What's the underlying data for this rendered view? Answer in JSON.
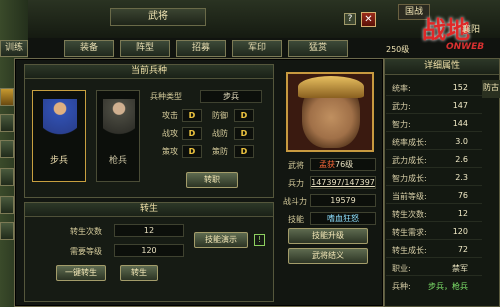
{
  "window": {
    "title": "武将",
    "help": "?",
    "close": "✕"
  },
  "top_right": {
    "label1": "国战",
    "label2": "襄阳",
    "logo": "战地",
    "logo_sub": "ONWEB",
    "badge": "250级"
  },
  "tabs": [
    {
      "label": "训练"
    },
    {
      "label": "装备"
    },
    {
      "label": "阵型"
    },
    {
      "label": "招募"
    },
    {
      "label": "军印"
    },
    {
      "label": "猛赏"
    }
  ],
  "unit_panel": {
    "title": "当前兵种",
    "portrait1_label": "步兵",
    "portrait2_label": "枪兵",
    "type_label": "兵种类型",
    "type_value": "步兵",
    "rows": [
      {
        "k1": "攻击",
        "v1": "D",
        "k2": "防御",
        "v2": "D"
      },
      {
        "k1": "战攻",
        "v1": "D",
        "k2": "战防",
        "v2": "D"
      },
      {
        "k1": "策攻",
        "v1": "D",
        "k2": "策防",
        "v2": "D"
      }
    ],
    "transfer_btn": "转职"
  },
  "rebirth_panel": {
    "title": "转生",
    "times_label": "转生次数",
    "times_value": "12",
    "level_label": "需要等级",
    "level_value": "120",
    "demo_btn": "技能演示",
    "hint": "!",
    "one_key_btn": "一键转生",
    "rebirth_btn": "转生"
  },
  "general": {
    "name_label": "武将",
    "name_value": "孟获",
    "level": "76级",
    "troops_label": "兵力",
    "troops_value": "147397/147397",
    "power_label": "战斗力",
    "power_value": "19579",
    "skill_label": "技能",
    "skill_value": "嗜血狂怒",
    "skill_up_btn": "技能升级",
    "info_btn": "武将结义"
  },
  "attributes": {
    "title": "详细属性",
    "side_label": "防古",
    "rows": [
      {
        "k": "统率:",
        "v": "152"
      },
      {
        "k": "武力:",
        "v": "147"
      },
      {
        "k": "智力:",
        "v": "144"
      },
      {
        "k": "统率成长:",
        "v": "3.0"
      },
      {
        "k": "武力成长:",
        "v": "2.6"
      },
      {
        "k": "智力成长:",
        "v": "2.3"
      },
      {
        "k": "当前等级:",
        "v": "76"
      },
      {
        "k": "转生次数:",
        "v": "12"
      },
      {
        "k": "转生需求:",
        "v": "120"
      },
      {
        "k": "转生成长:",
        "v": "72"
      },
      {
        "k": "职业:",
        "v": "禁军"
      },
      {
        "k": "兵种:",
        "v": "步兵，枪兵"
      }
    ]
  },
  "colors": {
    "accent": "#f0c640",
    "name": "#ff6a3a",
    "skill": "#8ee0ff",
    "type": "#7ee26a"
  }
}
